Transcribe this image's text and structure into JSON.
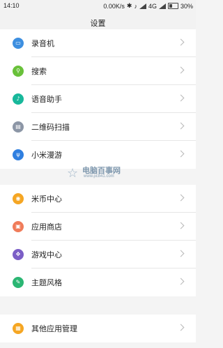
{
  "status": {
    "time": "14:10",
    "speed": "0.00K/s",
    "network": "4G",
    "battery": "30%"
  },
  "title": "设置",
  "groups": [
    {
      "items": [
        {
          "label": "录音机",
          "icon": "recorder-icon",
          "color": "#3d8fe0",
          "glyph": "▭"
        },
        {
          "label": "搜索",
          "icon": "search-icon",
          "color": "#69c13a",
          "glyph": "⚲"
        },
        {
          "label": "语音助手",
          "icon": "microphone-icon",
          "color": "#18b89b",
          "glyph": "♪"
        },
        {
          "label": "二维码扫描",
          "icon": "qr-scan-icon",
          "color": "#8c96a6",
          "glyph": "▤"
        },
        {
          "label": "小米漫游",
          "icon": "roaming-icon",
          "color": "#2f7fe0",
          "glyph": "ψ"
        }
      ]
    },
    {
      "items": [
        {
          "label": "米币中心",
          "icon": "coin-icon",
          "color": "#f5a623",
          "glyph": "◉"
        },
        {
          "label": "应用商店",
          "icon": "app-store-icon",
          "color": "#f07c5a",
          "glyph": "▣"
        },
        {
          "label": "游戏中心",
          "icon": "gamepad-icon",
          "color": "#7b5ec6",
          "glyph": "✥"
        },
        {
          "label": "主题风格",
          "icon": "theme-icon",
          "color": "#2bb673",
          "glyph": "✎"
        }
      ]
    },
    {
      "items": [
        {
          "label": "其他应用管理",
          "icon": "apps-grid-icon",
          "color": "#f5a623",
          "glyph": "▦"
        }
      ]
    }
  ],
  "watermark": {
    "name": "电脑百事网",
    "url": "www.pc841.com"
  }
}
